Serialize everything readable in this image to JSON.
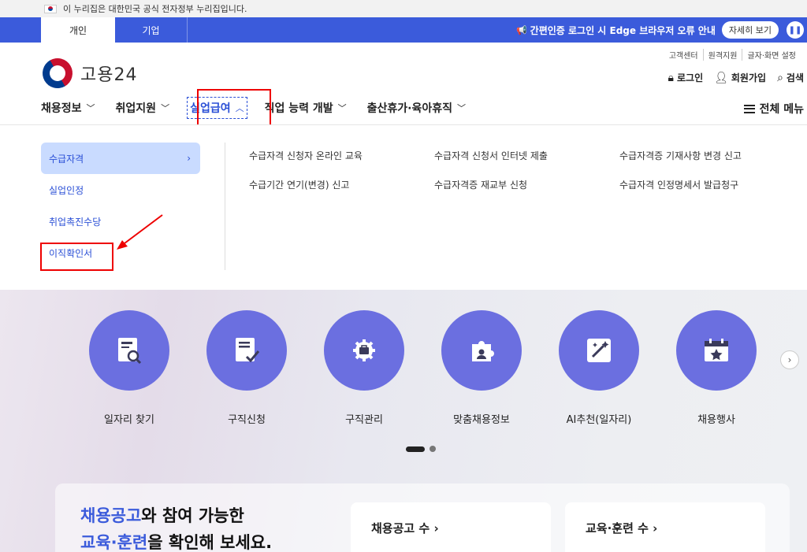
{
  "gov_banner": {
    "text": "이 누리집은 대한민국 공식 전자정부 누리집입니다."
  },
  "top_tabs": [
    {
      "label": "개인"
    },
    {
      "label": "기업"
    }
  ],
  "notice": {
    "text": "간편인증 로그인 시 Edge 브라우저 오류 안내",
    "detail_label": "자세히 보기"
  },
  "util_links": [
    "고객센터",
    "원격지원",
    "글자·화면 설정"
  ],
  "logo": {
    "text": "고용24"
  },
  "member": {
    "login": "로그인",
    "signup": "회원가입",
    "search": "검색"
  },
  "gnb": {
    "items": [
      {
        "label": "채용정보",
        "chev": "﹀"
      },
      {
        "label": "취업지원",
        "chev": "﹀"
      },
      {
        "label": "실업급여",
        "chev": "︿"
      },
      {
        "label": "직업 능력 개발",
        "chev": "﹀"
      },
      {
        "label": "출산휴가·육아휴직",
        "chev": "﹀"
      }
    ],
    "all_menu": "전체 메뉴"
  },
  "dropdown": {
    "side": [
      "수급자격",
      "실업인정",
      "취업촉진수당",
      "이직확인서"
    ],
    "side_selected_arrow": "›",
    "sub": [
      "수급자격 신청자 온라인 교육",
      "수급자격 신청서 인터넷 제출",
      "수급자격증 기재사항 변경 신고",
      "수급기간 연기(변경) 신고",
      "수급자격증 재교부 신청",
      "수급자격 인정명세서 발급청구"
    ]
  },
  "services": [
    {
      "label": "일자리 찾기",
      "icon": "job-search-icon"
    },
    {
      "label": "구직신청",
      "icon": "job-application-icon"
    },
    {
      "label": "구직관리",
      "icon": "job-management-icon"
    },
    {
      "label": "맞춤채용정보",
      "icon": "custom-job-info-icon"
    },
    {
      "label": "AI추천(일자리)",
      "icon": "ai-recommend-icon"
    },
    {
      "label": "채용행사",
      "icon": "job-event-icon"
    }
  ],
  "info": {
    "title_hl1": "채용공고",
    "title_rest1": "와 참여 가능한",
    "title_hl2": "교육·훈련",
    "title_rest2": "을 확인해 보세요.",
    "card1_label": "채용공고 수 ›",
    "card2_label": "교육·훈련 수 ›"
  },
  "colors": {
    "primary": "#3b5bdb",
    "service_circle": "#6b6fe0",
    "highlight_box": "#ee0000"
  }
}
